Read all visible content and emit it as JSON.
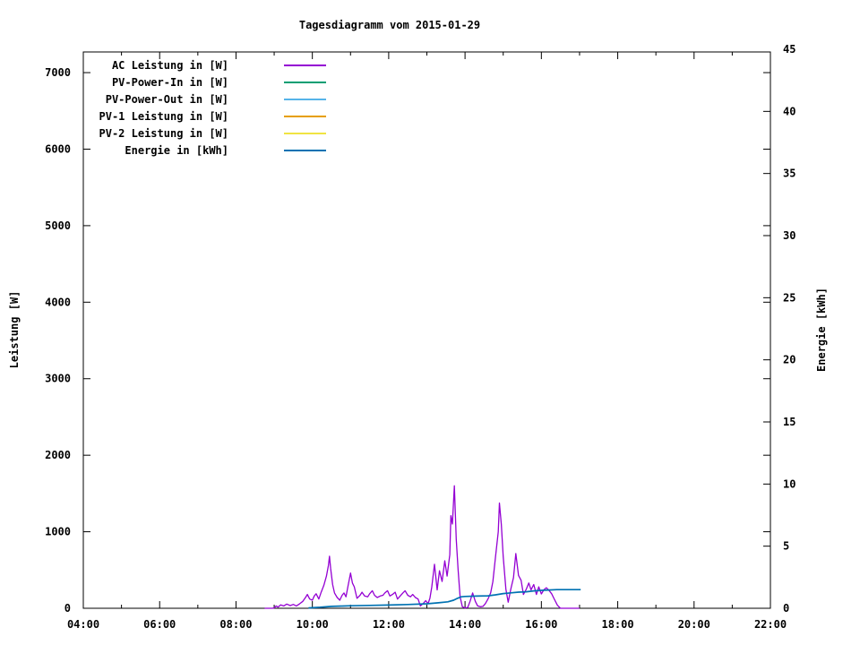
{
  "title": "Tagesdiagramm vom 2015-01-29",
  "colors": {
    "background": "#ffffff",
    "axis": "#000000",
    "text": "#000000",
    "ac_leistung": "#9400d3",
    "pv_power_in": "#009e73",
    "pv_power_out": "#56b4e9",
    "pv1_leistung": "#e69f00",
    "pv2_leistung": "#f0e442",
    "energie": "#0072b2"
  },
  "axes": {
    "x": {
      "major_ticks": [
        {
          "hour": 4,
          "label": "04:00"
        },
        {
          "hour": 6,
          "label": "06:00"
        },
        {
          "hour": 8,
          "label": "08:00"
        },
        {
          "hour": 10,
          "label": "10:00"
        },
        {
          "hour": 12,
          "label": "12:00"
        },
        {
          "hour": 14,
          "label": "14:00"
        },
        {
          "hour": 16,
          "label": "16:00"
        },
        {
          "hour": 18,
          "label": "18:00"
        },
        {
          "hour": 20,
          "label": "20:00"
        },
        {
          "hour": 22,
          "label": "22:00"
        }
      ],
      "minor_tick_hours": [
        5,
        7,
        9,
        11,
        13,
        15,
        17,
        19,
        21
      ],
      "range_hours": [
        4,
        22
      ]
    },
    "y_left": {
      "label": "Leistung [W]",
      "ticks": [
        {
          "value": 0,
          "label": "0"
        },
        {
          "value": 1000,
          "label": "1000"
        },
        {
          "value": 2000,
          "label": "2000"
        },
        {
          "value": 3000,
          "label": "3000"
        },
        {
          "value": 4000,
          "label": "4000"
        },
        {
          "value": 5000,
          "label": "5000"
        },
        {
          "value": 6000,
          "label": "6000"
        },
        {
          "value": 7000,
          "label": "7000"
        }
      ],
      "display_max": 7270
    },
    "y_right": {
      "label": "Energie [kWh]",
      "ticks": [
        {
          "value": 0,
          "label": "0"
        },
        {
          "value": 5,
          "label": "5"
        },
        {
          "value": 10,
          "label": "10"
        },
        {
          "value": 15,
          "label": "15"
        },
        {
          "value": 20,
          "label": "20"
        },
        {
          "value": 25,
          "label": "25"
        },
        {
          "value": 30,
          "label": "30"
        },
        {
          "value": 35,
          "label": "35"
        },
        {
          "value": 40,
          "label": "40"
        },
        {
          "value": 45,
          "label": "45"
        }
      ],
      "display_max": 45
    }
  },
  "legend": {
    "entries": [
      {
        "label": "AC Leistung in [W]",
        "color": "#9400d3"
      },
      {
        "label": "PV-Power-In in [W]",
        "color": "#009e73"
      },
      {
        "label": "PV-Power-Out in [W]",
        "color": "#56b4e9"
      },
      {
        "label": "PV-1 Leistung in [W]",
        "color": "#e69f00"
      },
      {
        "label": "PV-2 Leistung in [W]",
        "color": "#f0e442"
      },
      {
        "label": "Energie in [kWh]",
        "color": "#0072b2"
      }
    ]
  },
  "chart_data": {
    "type": "line",
    "title": "Tagesdiagramm vom 2015-01-29",
    "xlabel": "",
    "ylabel_left": "Leistung [W]",
    "ylabel_right": "Energie [kWh]",
    "x_unit": "hour_of_day",
    "x_range": [
      4,
      22
    ],
    "y_left_range": [
      0,
      7270
    ],
    "y_right_range": [
      0,
      45
    ],
    "grid": false,
    "legend_position": "top-left-inside",
    "series": [
      {
        "name": "AC Leistung in [W]",
        "color": "#9400d3",
        "axis": "left",
        "points": [
          [
            8.75,
            0
          ],
          [
            8.95,
            0
          ],
          [
            9.0,
            5
          ],
          [
            9.05,
            30
          ],
          [
            9.1,
            15
          ],
          [
            9.17,
            45
          ],
          [
            9.25,
            30
          ],
          [
            9.33,
            55
          ],
          [
            9.42,
            35
          ],
          [
            9.5,
            50
          ],
          [
            9.58,
            30
          ],
          [
            9.67,
            60
          ],
          [
            9.75,
            90
          ],
          [
            9.82,
            140
          ],
          [
            9.87,
            180
          ],
          [
            9.93,
            120
          ],
          [
            10.0,
            105
          ],
          [
            10.05,
            160
          ],
          [
            10.1,
            190
          ],
          [
            10.17,
            120
          ],
          [
            10.23,
            210
          ],
          [
            10.3,
            300
          ],
          [
            10.37,
            420
          ],
          [
            10.42,
            560
          ],
          [
            10.45,
            680
          ],
          [
            10.48,
            520
          ],
          [
            10.53,
            310
          ],
          [
            10.58,
            200
          ],
          [
            10.65,
            140
          ],
          [
            10.72,
            105
          ],
          [
            10.78,
            170
          ],
          [
            10.83,
            200
          ],
          [
            10.88,
            150
          ],
          [
            10.93,
            280
          ],
          [
            11.0,
            460
          ],
          [
            11.05,
            330
          ],
          [
            11.1,
            280
          ],
          [
            11.17,
            130
          ],
          [
            11.25,
            170
          ],
          [
            11.3,
            210
          ],
          [
            11.37,
            160
          ],
          [
            11.45,
            150
          ],
          [
            11.5,
            190
          ],
          [
            11.57,
            230
          ],
          [
            11.63,
            170
          ],
          [
            11.7,
            140
          ],
          [
            11.78,
            160
          ],
          [
            11.85,
            170
          ],
          [
            11.9,
            200
          ],
          [
            11.97,
            230
          ],
          [
            12.03,
            160
          ],
          [
            12.1,
            180
          ],
          [
            12.17,
            210
          ],
          [
            12.23,
            120
          ],
          [
            12.3,
            160
          ],
          [
            12.37,
            200
          ],
          [
            12.43,
            230
          ],
          [
            12.5,
            170
          ],
          [
            12.57,
            150
          ],
          [
            12.63,
            180
          ],
          [
            12.7,
            140
          ],
          [
            12.77,
            120
          ],
          [
            12.83,
            30
          ],
          [
            12.9,
            60
          ],
          [
            12.97,
            100
          ],
          [
            13.03,
            60
          ],
          [
            13.08,
            130
          ],
          [
            13.13,
            280
          ],
          [
            13.2,
            575
          ],
          [
            13.27,
            240
          ],
          [
            13.33,
            490
          ],
          [
            13.4,
            350
          ],
          [
            13.47,
            620
          ],
          [
            13.53,
            420
          ],
          [
            13.6,
            700
          ],
          [
            13.63,
            1210
          ],
          [
            13.67,
            1100
          ],
          [
            13.72,
            1600
          ],
          [
            13.77,
            900
          ],
          [
            13.82,
            500
          ],
          [
            13.87,
            150
          ],
          [
            13.93,
            20
          ],
          [
            14.0,
            5
          ],
          [
            14.07,
            10
          ],
          [
            14.13,
            90
          ],
          [
            14.2,
            200
          ],
          [
            14.27,
            90
          ],
          [
            14.33,
            30
          ],
          [
            14.4,
            20
          ],
          [
            14.47,
            25
          ],
          [
            14.53,
            60
          ],
          [
            14.6,
            120
          ],
          [
            14.67,
            200
          ],
          [
            14.73,
            350
          ],
          [
            14.8,
            680
          ],
          [
            14.87,
            1000
          ],
          [
            14.9,
            1375
          ],
          [
            14.95,
            1100
          ],
          [
            15.0,
            680
          ],
          [
            15.07,
            250
          ],
          [
            15.13,
            80
          ],
          [
            15.2,
            250
          ],
          [
            15.27,
            400
          ],
          [
            15.33,
            715
          ],
          [
            15.4,
            430
          ],
          [
            15.47,
            365
          ],
          [
            15.53,
            180
          ],
          [
            15.6,
            245
          ],
          [
            15.67,
            330
          ],
          [
            15.73,
            240
          ],
          [
            15.8,
            310
          ],
          [
            15.87,
            180
          ],
          [
            15.93,
            280
          ],
          [
            16.0,
            187
          ],
          [
            16.07,
            245
          ],
          [
            16.13,
            268
          ],
          [
            16.2,
            233
          ],
          [
            16.27,
            190
          ],
          [
            16.33,
            128
          ],
          [
            16.42,
            40
          ],
          [
            16.5,
            0
          ],
          [
            16.7,
            0
          ],
          [
            17.0,
            0
          ]
        ]
      },
      {
        "name": "PV-Power-In in [W]",
        "color": "#009e73",
        "axis": "left",
        "points": []
      },
      {
        "name": "PV-Power-Out in [W]",
        "color": "#56b4e9",
        "axis": "left",
        "points": []
      },
      {
        "name": "PV-1 Leistung in [W]",
        "color": "#e69f00",
        "axis": "left",
        "points": []
      },
      {
        "name": "PV-2 Leistung in [W]",
        "color": "#f0e442",
        "axis": "left",
        "points": []
      },
      {
        "name": "Energie in [kWh]",
        "color": "#0072b2",
        "axis": "right",
        "points": [
          [
            9.9,
            0.03
          ],
          [
            10.2,
            0.08
          ],
          [
            10.5,
            0.15
          ],
          [
            10.8,
            0.18
          ],
          [
            11.0,
            0.2
          ],
          [
            11.5,
            0.23
          ],
          [
            12.0,
            0.26
          ],
          [
            12.5,
            0.3
          ],
          [
            13.0,
            0.36
          ],
          [
            13.3,
            0.44
          ],
          [
            13.55,
            0.52
          ],
          [
            13.7,
            0.65
          ],
          [
            13.8,
            0.8
          ],
          [
            13.9,
            0.92
          ],
          [
            14.0,
            0.95
          ],
          [
            14.3,
            0.98
          ],
          [
            14.6,
            1.0
          ],
          [
            14.8,
            1.08
          ],
          [
            15.0,
            1.18
          ],
          [
            15.2,
            1.24
          ],
          [
            15.4,
            1.3
          ],
          [
            15.6,
            1.33
          ],
          [
            15.8,
            1.4
          ],
          [
            16.0,
            1.44
          ],
          [
            16.2,
            1.47
          ],
          [
            16.4,
            1.5
          ],
          [
            16.6,
            1.5
          ],
          [
            17.03,
            1.5
          ]
        ]
      }
    ]
  }
}
